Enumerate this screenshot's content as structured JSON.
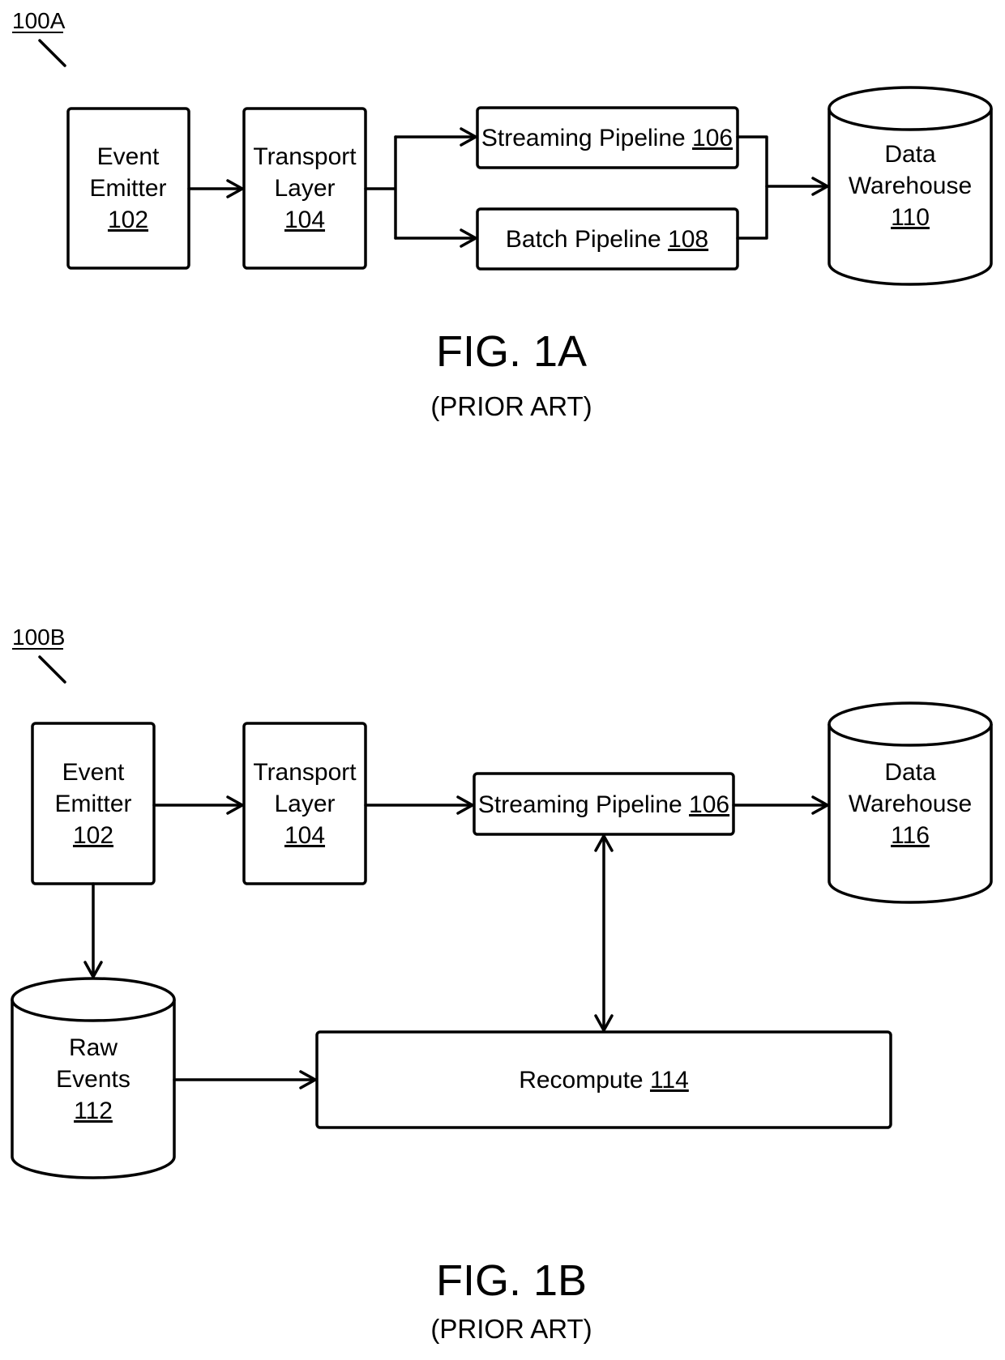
{
  "figure_a": {
    "ref_label": "100A",
    "caption": "FIG. 1A",
    "subcaption": "(PRIOR ART)",
    "nodes": {
      "event_emitter": {
        "line1": "Event",
        "line2": "Emitter",
        "ref": "102"
      },
      "transport_layer": {
        "line1": "Transport",
        "line2": "Layer",
        "ref": "104"
      },
      "streaming_pipeline": {
        "label": "Streaming Pipeline",
        "ref": "106"
      },
      "batch_pipeline": {
        "label": "Batch Pipeline",
        "ref": "108"
      },
      "data_warehouse": {
        "line1": "Data",
        "line2": "Warehouse",
        "ref": "110"
      }
    },
    "edges": [
      {
        "from": "event_emitter",
        "to": "transport_layer"
      },
      {
        "from": "transport_layer",
        "to": "streaming_pipeline"
      },
      {
        "from": "transport_layer",
        "to": "batch_pipeline"
      },
      {
        "from": "streaming_pipeline",
        "to": "data_warehouse"
      },
      {
        "from": "batch_pipeline",
        "to": "data_warehouse"
      }
    ]
  },
  "figure_b": {
    "ref_label": "100B",
    "caption": "FIG. 1B",
    "subcaption": "(PRIOR ART)",
    "nodes": {
      "event_emitter": {
        "line1": "Event",
        "line2": "Emitter",
        "ref": "102"
      },
      "transport_layer": {
        "line1": "Transport",
        "line2": "Layer",
        "ref": "104"
      },
      "streaming_pipeline": {
        "label": "Streaming Pipeline",
        "ref": "106"
      },
      "data_warehouse": {
        "line1": "Data",
        "line2": "Warehouse",
        "ref": "116"
      },
      "raw_events": {
        "line1": "Raw",
        "line2": "Events",
        "ref": "112"
      },
      "recompute": {
        "label": "Recompute",
        "ref": "114"
      }
    },
    "edges": [
      {
        "from": "event_emitter",
        "to": "transport_layer"
      },
      {
        "from": "transport_layer",
        "to": "streaming_pipeline"
      },
      {
        "from": "streaming_pipeline",
        "to": "data_warehouse"
      },
      {
        "from": "event_emitter",
        "to": "raw_events"
      },
      {
        "from": "raw_events",
        "to": "recompute"
      },
      {
        "from": "recompute",
        "to": "streaming_pipeline",
        "bidirectional": true
      }
    ]
  }
}
